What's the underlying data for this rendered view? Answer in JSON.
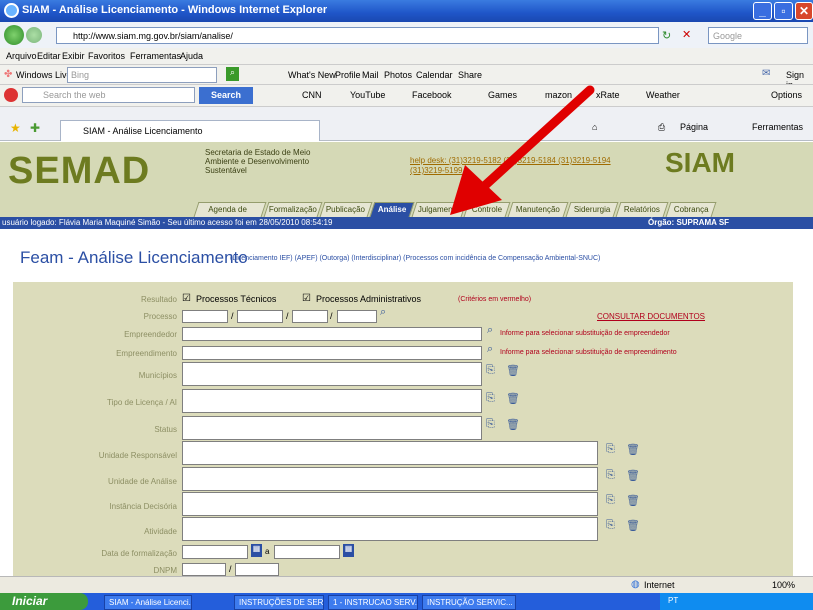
{
  "window": {
    "title": "SIAM - Análise Licenciamento - Windows Internet Explorer"
  },
  "address": {
    "url": "http://www.siam.mg.gov.br/siam/analise/",
    "search_placeholder": "Google"
  },
  "menu": [
    "Arquivo",
    "Editar",
    "Exibir",
    "Favoritos",
    "Ferramentas",
    "Ajuda"
  ],
  "links_bar": {
    "windows_live": "Windows Live",
    "bing": "Bing",
    "whats_new": "What's New",
    "profile": "Profile",
    "mail": "Mail",
    "photos": "Photos",
    "calendar": "Calendar",
    "share": "Share",
    "sign_in": "Sign in"
  },
  "toolbar2": {
    "search_placeholder": "Search the web",
    "search_btn": "Search",
    "cnn": "CNN",
    "youtube": "YouTube",
    "facebook": "Facebook",
    "games": "Games",
    "amazon": "mazon",
    "xrate": "xRate",
    "weather": "Weather",
    "options": "Options"
  },
  "tab": {
    "title": "SIAM - Análise Licenciamento",
    "pagina": "Página",
    "ferramentas": "Ferramentas"
  },
  "header": {
    "logo": "SEMAD",
    "secretaria": "Secretaria de Estado de Meio Ambiente e Desenvolvimento Sustentável",
    "help": "help desk: (31)3219-5182 (31)3219-5184 (31)3219-5194 (31)3219-5199",
    "siam": "SIAM"
  },
  "nav_tabs": [
    "Agenda de Trabalho",
    "Formalização",
    "Publicação",
    "Análise",
    "Julgamento",
    "Controle",
    "Manutenção",
    "Siderurgia",
    "Relatórios",
    "Cobrança"
  ],
  "user_bar": {
    "left": "usuário logado: Flávia Maria Maquiné Simão - Seu último acesso foi em 28/05/2010 08:54:19",
    "right": "Órgão: SUPRAMA SF"
  },
  "page": {
    "title": "Feam - Análise Licenciamento",
    "links": "(Licenciamento IEF) (APEF) (Outorga) (Interdisciplinar) (Processos com incidência de Compensação Ambiental-SNUC)"
  },
  "form": {
    "resultado_label": "Resultado",
    "opt_tecnicos": "Processos Técnicos",
    "opt_admin": "Processos Administrativos",
    "criterio": "(Critérios em vermelho)",
    "consultar": "CONSULTAR DOCUMENTOS",
    "processo": "Processo",
    "empreendedor": "Empreendedor",
    "empreendimento": "Empreendimento",
    "hint_empreendedor": "Informe para selecionar substituição de empreendedor",
    "hint_empreendimento": "Informe para selecionar substituição de empreendimento",
    "municipios": "Municípios",
    "tipo_licenca": "Tipo de Licença / AI",
    "status": "Status",
    "unidade_resp": "Unidade Responsável",
    "unidade_analise": "Unidade de Análise",
    "instancia": "Instância Decisória",
    "atividade": "Atividade",
    "data_form": "Data de formalização",
    "data_sep": "a",
    "dnpm": "DNPM"
  },
  "statusbar": {
    "zone": "Internet",
    "zoom": "100%"
  },
  "taskbar": {
    "start": "Iniciar",
    "items": [
      "SIAM - Análise Licenci...",
      "INSTRUÇÕES DE SERV...",
      "1 - INSTRUCAO SERV...",
      "INSTRUÇÃO SERVIC..."
    ],
    "tray": "PT"
  },
  "colors": {
    "accent": "#2b4fa4",
    "header_bg": "#d5d9b6",
    "form_bg": "#dcdcbb",
    "arrow": "#e00000"
  }
}
